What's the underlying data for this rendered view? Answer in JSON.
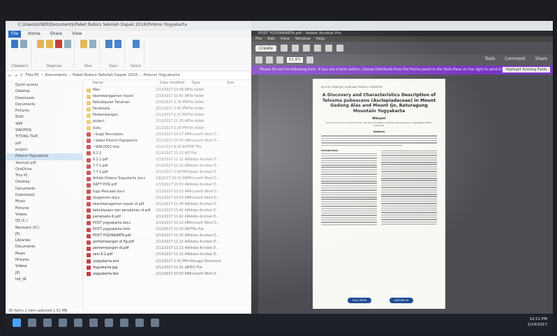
{
  "explorer": {
    "window_title": "C:\\Users\\USER\\Documents\\Paket Rubics Sekolah Dapak 2016\\Potensi Yogyakarta",
    "ribbon_tabs": [
      "File",
      "Home",
      "Share",
      "View"
    ],
    "ribbon_groups": [
      "Clipboard",
      "Organize",
      "New",
      "Open",
      "Select"
    ],
    "ribbon_buttons": {
      "copy_path": "Copy path",
      "paste_shortcut": "Paste shortcut",
      "move_to": "Move to",
      "copy_to": "Copy to",
      "delete": "Delete",
      "rename": "Rename",
      "new_folder": "New folder",
      "new_item": "New item",
      "properties": "Properties",
      "open": "Open",
      "select_all": "Select all"
    },
    "breadcrumb": [
      "This PC",
      "Documents",
      "Paket Rubics Sekolah Dapak 2016",
      "Potensi Yogyakarta"
    ],
    "nav_items": [
      "Quick access",
      "Desktop",
      "Downloads",
      "Documents",
      "Pictures",
      "BUKI",
      "SMP",
      "SINOPSIS",
      "TITONG T&M",
      "pdf",
      "project",
      "Potensi Yogyakarta",
      "Yamnah pdf",
      "OneDrive",
      "This PC",
      "Desktop",
      "Documents",
      "Downloads",
      "Music",
      "Pictures",
      "Videos",
      "OS (C:)",
      "Recovery (D:)",
      "JFL",
      "Libraries",
      "Documents",
      "Music",
      "Pictures",
      "Videos",
      "JFL",
      "hdl_tR"
    ],
    "column_headers": {
      "name": "Name",
      "date": "Date modified",
      "type": "Type",
      "size": "Size"
    },
    "files": [
      {
        "name": "files",
        "date": "2/13/2017 10:08 AM",
        "type": "File folder",
        "kind": "folder"
      },
      {
        "name": "keanekaragaman hayati",
        "date": "2/10/2017 10:42 AM",
        "type": "File folder",
        "kind": "folder"
      },
      {
        "name": "Kebudayaan Tanaman",
        "date": "2/10/2017 2:26 PM",
        "type": "File folder",
        "kind": "folder"
      },
      {
        "name": "Pariwisata",
        "date": "2/11/2017 2:45 PM",
        "type": "File folder",
        "kind": "folder"
      },
      {
        "name": "Perkembangan",
        "date": "2/11/2017 2:21 PM",
        "type": "File folder",
        "kind": "folder"
      },
      {
        "name": "project",
        "date": "2/13/2017 11:33 AM",
        "type": "File folder",
        "kind": "folder"
      },
      {
        "name": "Suku",
        "date": "2/11/2017 2:24 PM",
        "type": "File folder",
        "kind": "folder"
      },
      {
        "name": "~$uga Penceabas",
        "date": "2/13/2017 10:27 AM",
        "type": "Microsoft Word D...",
        "kind": "doc"
      },
      {
        "name": "~$akel Potensi Yogyakarta",
        "date": "2/11/2017 10:54 AM",
        "type": "Microsoft Word D...",
        "kind": "doc"
      },
      {
        "name": "~WRL0001.tmp",
        "date": "2/11/2017 9:39 AM",
        "type": "TMP File",
        "kind": "doc"
      },
      {
        "name": "6.2.2",
        "date": "2/13/2017 11:22 AM",
        "type": "3 File",
        "kind": "doc"
      },
      {
        "name": "6.2.2.pdf",
        "date": "2/13/2017 11:22 AM",
        "type": "Adobe Acrobat D...",
        "kind": "doc"
      },
      {
        "name": "7.7.1.pdf",
        "date": "2/13/2017 11:22 AM",
        "type": "Adobe Acrobat D...",
        "kind": "doc"
      },
      {
        "name": "7.7.1.pdf",
        "date": "2/11/2017 1:08 PM",
        "type": "Adobe Acrobat D...",
        "kind": "doc"
      },
      {
        "name": "Artikel Potensi Yogyakarta docx",
        "date": "2/8/2017 10:31 AM",
        "type": "Microsoft Word D...",
        "kind": "doc"
      },
      {
        "name": "DAFT POSI.pdf",
        "date": "2/13/2017 10:53 AM",
        "type": "Adobe Acrobat D...",
        "kind": "doc"
      },
      {
        "name": "fugu Pencaba.docx",
        "date": "2/13/2017 10:53 AM",
        "type": "Microsoft Word D...",
        "kind": "doc"
      },
      {
        "name": "jitogamoni.docx",
        "date": "2/11/2017 10:53 AM",
        "type": "Microsoft Word D...",
        "kind": "doc"
      },
      {
        "name": "keanekaragaman hayati di.pdf",
        "date": "2/11/2017 11:44 AM",
        "type": "Adobe Acrobat D...",
        "kind": "doc"
      },
      {
        "name": "kebudayaan dan perubahan di.pdf",
        "date": "2/11/2017 11:42 AM",
        "type": "Adobe Acrobat D...",
        "kind": "doc"
      },
      {
        "name": "pariwisata di.pdf",
        "date": "2/11/2017 11:42 AM",
        "type": "Adobe Acrobat D...",
        "kind": "doc"
      },
      {
        "name": "POST yogyakarta.docx",
        "date": "2/13/2017 10:11 AM",
        "type": "Microsoft Word D...",
        "kind": "doc"
      },
      {
        "name": "POST yogyakarta.html",
        "date": "2/13/2017 11:03 AM",
        "type": "HTML File",
        "kind": "doc"
      },
      {
        "name": "POST YOGYAKARTA.pdf",
        "date": "2/13/2017 11:03 AM",
        "type": "Adobe Acrobat D...",
        "kind": "doc"
      },
      {
        "name": "perkembangan di fig.pdf",
        "date": "2/13/2017 11:22 AM",
        "type": "Adobe Acrobat D...",
        "kind": "doc"
      },
      {
        "name": "perkembangan di.pdf",
        "date": "2/11/2017 11:22 AM",
        "type": "Adobe Acrobat D...",
        "kind": "doc"
      },
      {
        "name": "seni 6.2.pdf",
        "date": "2/13/2017 11:22 AM",
        "type": "Adobe Acrobat D...",
        "kind": "doc"
      },
      {
        "name": "yogyakarta.eml",
        "date": "2/13/2017 1:05 PM",
        "type": "mShrage Document",
        "kind": "doc"
      },
      {
        "name": "Yogyakarta.jpg",
        "date": "2/11/2017 11:51 AM",
        "type": "JPEG File",
        "kind": "doc"
      },
      {
        "name": "yogyakarta.doc",
        "date": "2/11/2017 10:55 AM",
        "type": "Microsoft Word 9...",
        "kind": "doc"
      }
    ],
    "status": "30 items   1 item selected   1.51 MB"
  },
  "acrobat": {
    "window_title": "POST YOGYAKARTA.pdf - Adobe Acrobat Pro",
    "menu": [
      "File",
      "Edit",
      "View",
      "Window",
      "Help"
    ],
    "create_label": "Create",
    "zoom": "81.8%",
    "panels": [
      "Tools",
      "Comment",
      "Share"
    ],
    "banner": "Please fill out the following form. If you are a form author, choose Distribute from the Forms panel in the Tools Pane on the right to send it to others.",
    "highlight_button": "Highlight Existing Fields",
    "paper": {
      "journal": "BIOLOGY, MEDICINE, & NATURAL PRODUCT CHEMISTRY",
      "title": "A Discovery and Characteristics Description of Telosma pubescens (Asclepiadaceae) in Mount Gedong Alas and Mount Ijo, Baturagung Mountain Yogyakarta",
      "author": "Wahyuni",
      "affiliation": "Faculty of Science and Technology, UIN Sunan Kalijaga, Jl. Marsda Adisucipto No.1 Yogyakarta 55281, Indonesia",
      "abstract_heading": "Abstract",
      "intro_heading": "Introduction",
      "buttons": [
        "FULL ISSUE",
        "DAFTAR ISI"
      ]
    }
  },
  "taskbar": {
    "time": "12:11 PM",
    "date": "2/14/2017"
  }
}
